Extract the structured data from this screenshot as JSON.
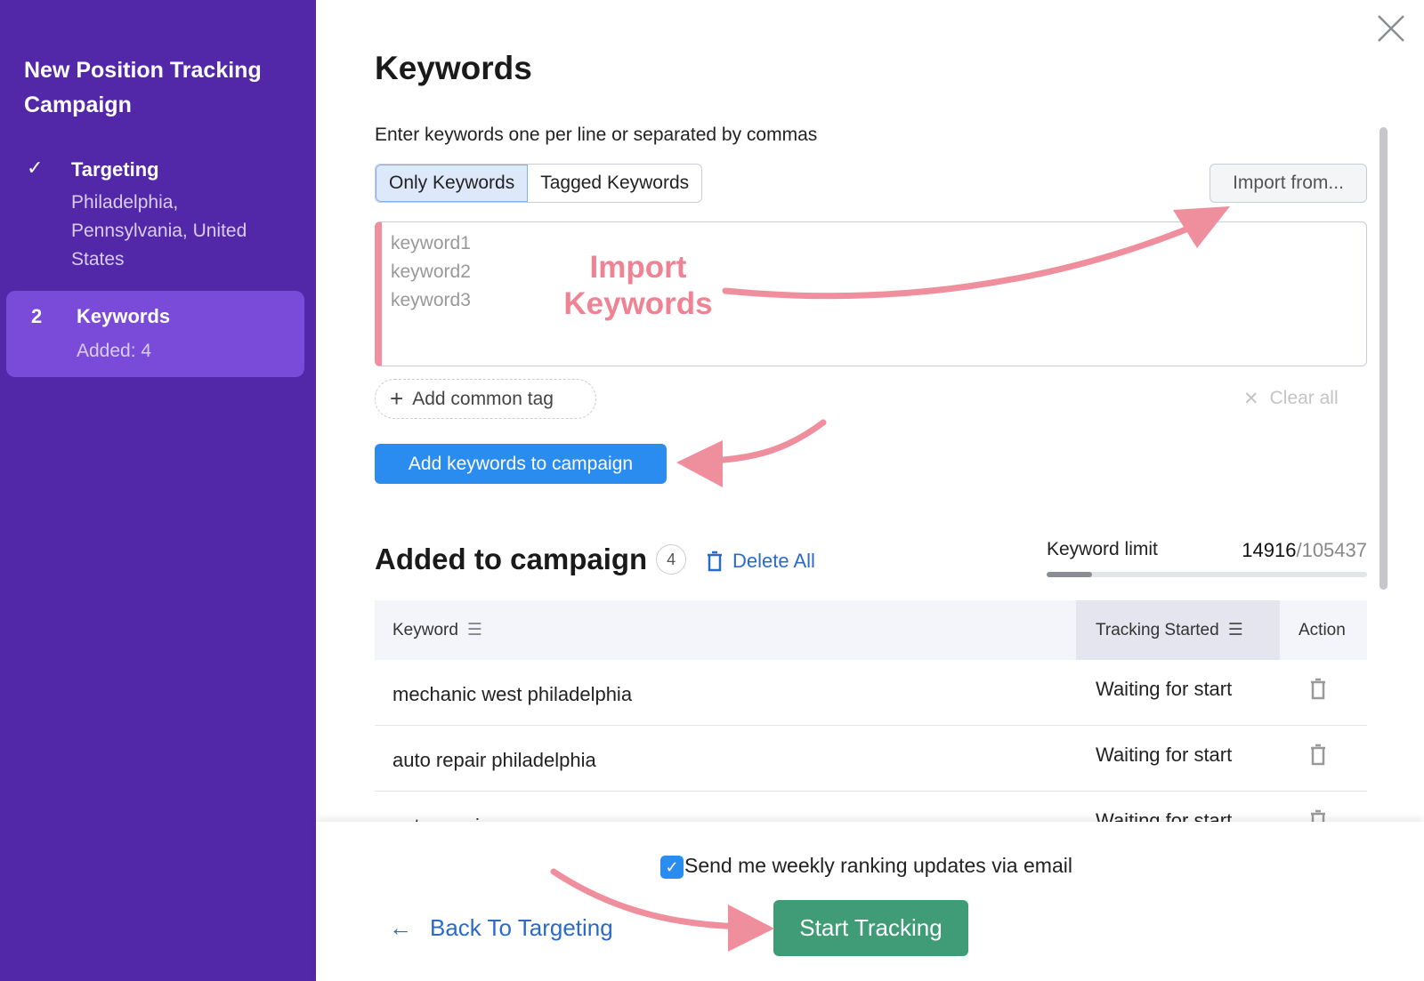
{
  "sidebar": {
    "title": "New Position Tracking Campaign",
    "steps": [
      {
        "marker": "✓",
        "label": "Targeting",
        "detail_lines": [
          "Philadelphia,",
          "Pennsylvania, United",
          "States"
        ]
      },
      {
        "marker": "2",
        "label": "Keywords",
        "detail": "Added: 4",
        "active": true
      }
    ]
  },
  "main": {
    "title": "Keywords",
    "instruction": "Enter keywords one per line or separated by commas",
    "tabs": [
      {
        "label": "Only Keywords",
        "active": true
      },
      {
        "label": "Tagged Keywords",
        "active": false
      }
    ],
    "import_label": "Import from...",
    "textarea_placeholder": [
      "keyword1",
      "keyword2",
      "keyword3"
    ],
    "add_tag_label": "Add common tag",
    "clear_all_label": "Clear all",
    "add_button_label": "Add keywords to campaign",
    "added_title": "Added to campaign",
    "added_count": "4",
    "delete_all_label": "Delete All",
    "keyword_limit": {
      "label": "Keyword limit",
      "used": "14916",
      "total": "/105437",
      "fraction": 0.1415
    },
    "table": {
      "headers": [
        "Keyword",
        "Tracking Started",
        "Action"
      ],
      "rows": [
        {
          "keyword": "mechanic west philadelphia",
          "status": "Waiting for start"
        },
        {
          "keyword": "auto repair philadelphia",
          "status": "Waiting for start"
        },
        {
          "keyword": "auto repair pa",
          "status": "Waiting for start"
        }
      ]
    }
  },
  "footer": {
    "email_checkbox_label": "Send me weekly ranking updates via email",
    "email_checked": true,
    "back_label": "Back To Targeting",
    "start_label": "Start Tracking"
  },
  "annotation": {
    "text": "Import Keywords",
    "color": "#ef8393"
  },
  "colors": {
    "sidebar": "#5228a8",
    "active_step": "#7a4bd8",
    "primary": "#2b8cf0",
    "success": "#3f9c77"
  }
}
